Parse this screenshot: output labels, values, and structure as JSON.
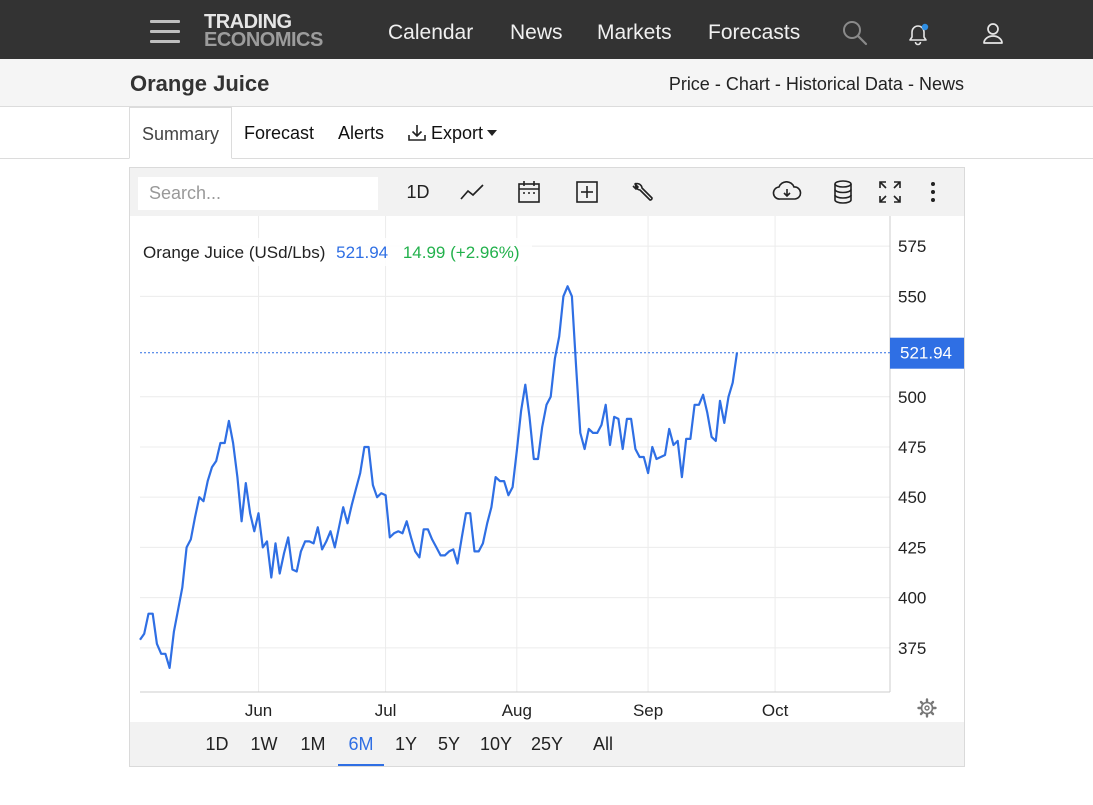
{
  "nav": {
    "logo_line1": "TRADING",
    "logo_line2": "ECONOMICS",
    "links": [
      "Calendar",
      "News",
      "Markets",
      "Forecasts"
    ]
  },
  "header": {
    "title": "Orange Juice",
    "crumbs": [
      "Price",
      "Chart",
      "Historical Data",
      "News"
    ],
    "crumb_separator": "-"
  },
  "tabs": [
    "Summary",
    "Forecast",
    "Alerts",
    "Export"
  ],
  "toolbar": {
    "search_placeholder": "Search...",
    "interval_label": "1D"
  },
  "chart_data": {
    "type": "line",
    "legend_name": "Orange Juice (USd/Lbs)",
    "legend_price": "521.94",
    "legend_change": "14.99 (+2.96%)",
    "last_price_label": "521.94",
    "last_value": 521.94,
    "y_ticks": [
      375,
      400,
      425,
      450,
      475,
      500,
      550,
      575
    ],
    "y_range": [
      353,
      590
    ],
    "x_tick_labels": [
      "Jun",
      "Jul",
      "Aug",
      "Sep",
      "Oct"
    ],
    "x_tick_dates": [
      "2024-06-01",
      "2024-07-01",
      "2024-08-01",
      "2024-09-01",
      "2024-10-01"
    ],
    "x_range": [
      "2024-05-04",
      "2024-10-22"
    ],
    "grid": true,
    "colors": {
      "line": "#2f6fe4",
      "positive": "#22b14c",
      "accent": "#2f6fe4"
    },
    "dates": [
      "2024-05-04",
      "2024-05-05",
      "2024-05-06",
      "2024-05-07",
      "2024-05-08",
      "2024-05-09",
      "2024-05-10",
      "2024-05-11",
      "2024-05-12",
      "2024-05-13",
      "2024-05-14",
      "2024-05-15",
      "2024-05-16",
      "2024-05-17",
      "2024-05-18",
      "2024-05-19",
      "2024-05-20",
      "2024-05-21",
      "2024-05-22",
      "2024-05-23",
      "2024-05-24",
      "2024-05-25",
      "2024-05-26",
      "2024-05-27",
      "2024-05-28",
      "2024-05-29",
      "2024-05-30",
      "2024-05-31",
      "2024-06-01",
      "2024-06-02",
      "2024-06-03",
      "2024-06-04",
      "2024-06-05",
      "2024-06-06",
      "2024-06-07",
      "2024-06-08",
      "2024-06-09",
      "2024-06-10",
      "2024-06-11",
      "2024-06-12",
      "2024-06-13",
      "2024-06-14",
      "2024-06-15",
      "2024-06-16",
      "2024-06-17",
      "2024-06-18",
      "2024-06-19",
      "2024-06-20",
      "2024-06-21",
      "2024-06-22",
      "2024-06-23",
      "2024-06-24",
      "2024-06-25",
      "2024-06-26",
      "2024-06-27",
      "2024-06-28",
      "2024-06-29",
      "2024-06-30",
      "2024-07-01",
      "2024-07-02",
      "2024-07-03",
      "2024-07-04",
      "2024-07-05",
      "2024-07-06",
      "2024-07-07",
      "2024-07-08",
      "2024-07-09",
      "2024-07-10",
      "2024-07-11",
      "2024-07-12",
      "2024-07-13",
      "2024-07-14",
      "2024-07-15",
      "2024-07-16",
      "2024-07-17",
      "2024-07-18",
      "2024-07-19",
      "2024-07-20",
      "2024-07-21",
      "2024-07-22",
      "2024-07-23",
      "2024-07-24",
      "2024-07-25",
      "2024-07-26",
      "2024-07-27",
      "2024-07-28",
      "2024-07-29",
      "2024-07-30",
      "2024-07-31",
      "2024-08-01",
      "2024-08-02",
      "2024-08-03",
      "2024-08-04",
      "2024-08-05",
      "2024-08-06",
      "2024-08-07",
      "2024-08-08",
      "2024-08-09",
      "2024-08-10",
      "2024-08-11",
      "2024-08-12",
      "2024-08-13",
      "2024-08-14",
      "2024-08-15",
      "2024-08-16",
      "2024-08-17",
      "2024-08-18",
      "2024-08-19",
      "2024-08-20",
      "2024-08-21",
      "2024-08-22",
      "2024-08-23",
      "2024-08-24",
      "2024-08-25",
      "2024-08-26",
      "2024-08-27",
      "2024-08-28",
      "2024-08-29",
      "2024-08-30",
      "2024-08-31",
      "2024-09-01",
      "2024-09-02",
      "2024-09-03",
      "2024-09-04",
      "2024-09-05",
      "2024-09-06",
      "2024-09-07",
      "2024-09-08",
      "2024-09-09",
      "2024-09-10",
      "2024-09-11",
      "2024-09-12",
      "2024-09-13",
      "2024-09-14",
      "2024-09-15",
      "2024-09-16",
      "2024-09-17",
      "2024-09-18",
      "2024-09-19",
      "2024-09-20",
      "2024-09-21",
      "2024-09-22",
      "2024-09-23",
      "2024-09-24",
      "2024-09-25",
      "2024-09-26",
      "2024-09-27",
      "2024-09-28",
      "2024-09-29",
      "2024-09-30",
      "2024-10-01",
      "2024-10-02",
      "2024-10-03",
      "2024-10-04",
      "2024-10-05",
      "2024-10-06",
      "2024-10-07",
      "2024-10-08",
      "2024-10-09",
      "2024-10-10",
      "2024-10-11",
      "2024-10-12",
      "2024-10-13",
      "2024-10-14",
      "2024-10-15",
      "2024-10-16",
      "2024-10-17",
      "2024-10-18",
      "2024-10-19",
      "2024-10-20",
      "2024-10-21",
      "2024-10-22"
    ],
    "values": [
      379,
      382,
      392,
      392,
      377,
      372,
      372,
      365,
      383,
      394,
      405,
      425,
      429,
      440,
      450,
      448,
      458,
      465,
      468,
      477,
      477,
      488,
      477,
      460,
      438,
      457,
      442,
      433,
      442,
      425,
      428,
      410,
      427,
      412,
      422,
      430,
      414,
      413,
      423,
      428,
      428,
      427,
      435,
      424,
      428,
      433,
      425,
      435,
      445,
      437,
      446,
      454,
      462,
      475,
      475,
      456,
      450,
      452,
      451,
      430,
      432,
      433,
      432,
      438,
      430,
      423,
      420,
      434,
      434,
      429,
      425,
      421,
      421,
      423,
      424,
      417,
      430,
      442,
      442,
      423,
      423,
      427,
      437,
      445,
      460,
      458,
      458,
      451,
      455,
      473,
      493,
      506,
      490,
      469,
      469,
      485,
      496,
      500,
      519,
      530,
      550,
      555,
      550,
      515,
      482,
      474,
      484,
      482,
      482,
      486,
      496,
      476,
      490,
      489,
      474,
      489,
      489,
      474,
      470,
      470,
      462,
      475,
      469,
      470,
      471,
      484,
      476,
      478,
      460,
      479,
      479,
      496,
      496,
      501,
      492,
      480,
      478,
      498,
      487,
      500,
      507,
      522
    ]
  },
  "range_buttons": [
    "1D",
    "1W",
    "1M",
    "6M",
    "1Y",
    "5Y",
    "10Y",
    "25Y",
    "All"
  ],
  "active_range": "6M"
}
